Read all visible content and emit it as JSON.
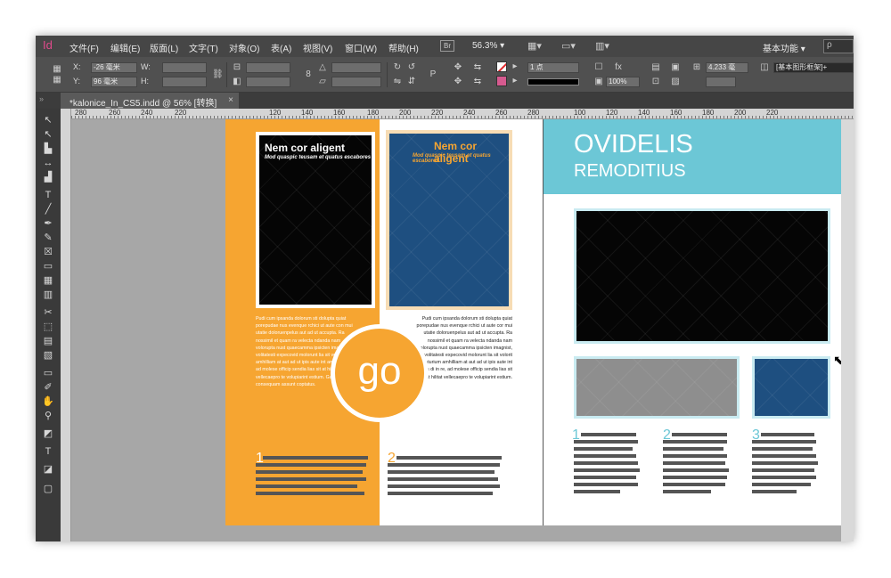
{
  "app": {
    "logo": "Id"
  },
  "menubar": {
    "items": [
      "文件(F)",
      "编辑(E)",
      "版面(L)",
      "文字(T)",
      "对象(O)",
      "表(A)",
      "视图(V)",
      "窗口(W)",
      "帮助(H)"
    ],
    "bridge_badge": "Br",
    "zoom": "56.3%",
    "workspace": "基本功能",
    "search_placeholder": "ρ"
  },
  "controlbar": {
    "x_label": "X:",
    "x_value": "-26 毫米",
    "y_label": "Y:",
    "y_value": "96 毫米",
    "w_label": "W:",
    "h_label": "H:",
    "stroke_weight": "1 点",
    "opacity": "100%",
    "gap_value": "4.233 毫",
    "frame_style": "[基本图形框架]+"
  },
  "tab": {
    "label": "*kalonice_In_CS5.indd @ 56% [转换]",
    "close": "×"
  },
  "ruler": {
    "ticks": [
      "280",
      "260",
      "240",
      "220",
      "120",
      "140",
      "160",
      "180",
      "200",
      "220",
      "240",
      "260",
      "280",
      "100",
      "120",
      "140",
      "160",
      "180",
      "200",
      "220"
    ]
  },
  "colors": {
    "accent_orange": "#f6a531",
    "teal": "#6cc7d6",
    "navy": "#1e4f80",
    "bar_gray": "#555555"
  },
  "left_page": {
    "frame1_title": "Nem cor aligent",
    "frame1_sub": "Mod quaspic teusam et quatus escabores",
    "frame2_title": "Nem cor aligent",
    "frame2_sub": "Mod quaspic teusam et quatus escabores",
    "col1_text": "Pudi cum ipsanda dolorum sti dolupta quiat porepudae nus evenque rchici ut aute con mui utatie doloruenpelus aut ad ut accupta. Ra nossimil et quam ra velecta ndanda nam volorupta nust quaecamma ipsicten imagnis, volitatesti expecovid molorunt lia sit volorit aturium amhilliam at aut ad ut ipis aute int amnis di in re, ad molese officip sendia lias sit at hilitat vellecaepro te volupiarint estium. Ga. Nequis consequam assunt coptatus.",
    "col2_text": "Pudi cum ipsanda dolorum sti dolupta quiat porepudae nus evenque rchici ut aute cor mui utatie doloruenpelus aut ad ut accupta. Ra nossimil et quam ra velecta ndanda nam volorupta nust quaecamma ipsicten imagnist, volitatesti expecovid molorunt lia sit volorit aturium amhilliam at aut ad ut ipis aute int amnis di in re, ad molese officip sendia lias sit at hilitat vellecaepro te volupiarint estium.",
    "go": "go",
    "num1": "1",
    "num2": "2"
  },
  "right_page": {
    "title": "OVIDELIS",
    "subtitle": "REMODITIUS",
    "num1": "1",
    "num2": "2",
    "num3": "3"
  }
}
